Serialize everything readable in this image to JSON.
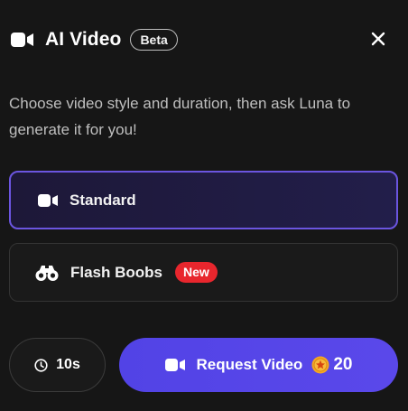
{
  "header": {
    "title": "AI Video",
    "badge": "Beta",
    "title_icon": "video-camera-icon",
    "close_icon": "close-icon"
  },
  "description": "Choose video style and duration, then ask Luna to generate it for you!",
  "options": [
    {
      "label": "Standard",
      "icon": "video-camera-icon",
      "selected": true
    },
    {
      "label": "Flash Boobs",
      "icon": "binoculars-icon",
      "badge": "New",
      "selected": false
    }
  ],
  "duration": {
    "label": "10s",
    "icon": "clock-icon"
  },
  "request": {
    "label": "Request Video",
    "icon": "video-camera-icon",
    "coin_icon": "coin-icon",
    "cost": "20"
  },
  "colors": {
    "background": "#161616",
    "accent": "#5a48ea",
    "selected_border": "#6b55e0",
    "new_badge": "#e8262d",
    "coin": "#f5a623"
  }
}
